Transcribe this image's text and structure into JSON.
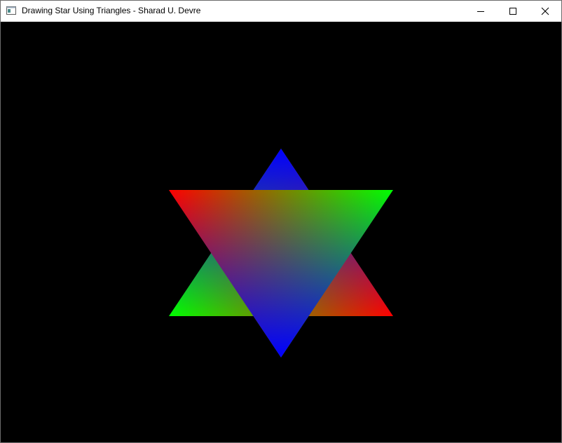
{
  "window": {
    "title": "Drawing Star Using Triangles - Sharad U. Devre",
    "controls": {
      "minimize_icon": "minimize-icon",
      "maximize_icon": "maximize-icon",
      "close_icon": "close-icon"
    }
  },
  "canvas": {
    "background": "#000000",
    "shape": "hexagram",
    "triangle_up_colors": [
      "#0000ff",
      "#00ff00",
      "#ff0000"
    ],
    "triangle_down_colors": [
      "#ff0000",
      "#00ff00",
      "#0000ff"
    ]
  }
}
